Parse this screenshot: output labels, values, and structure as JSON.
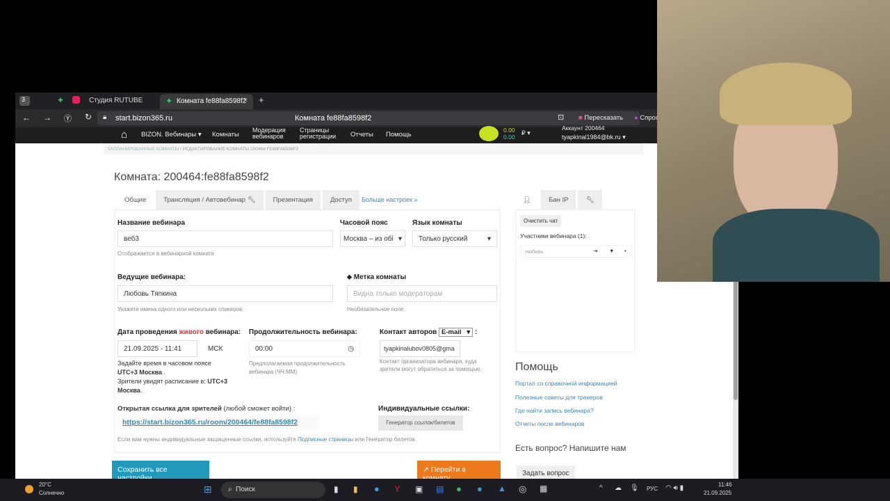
{
  "browser": {
    "tabs": [
      {
        "label": "Студия RUTUBE"
      },
      {
        "label": "Комната fe88fa8598f2"
      }
    ],
    "tab_count": "3",
    "url": "start.bizon365.ru",
    "page_title": "Комната fe88fa8598f2",
    "retell": "Пересказать",
    "ask": "Спросить"
  },
  "nav": {
    "brand": "BIZON. Вебинары",
    "items": [
      "Комнаты",
      "Модерация вебинаров",
      "Страницы регистрации",
      "Отчеты",
      "Помощь"
    ],
    "balance1": "0.00",
    "balance2": "0.00",
    "currency": "₽",
    "account": "Аккаунт 200464",
    "email": "tyapkinal1984@bk.ru"
  },
  "breadcrumb": {
    "item1": "ЗАПЛАНИРОВАННЫЕ КОМНАТЫ",
    "item2": "РЕДАКТИРОВАНИЕ КОМНАТЫ 200464:FE88FA8598F2"
  },
  "room": {
    "title": "Комната: 200464:fe88fa8598f2",
    "tabs": [
      "Общие",
      "Трансляция / Автовебинар",
      "Презентация",
      "Доступ"
    ],
    "more": "Больше настроек »",
    "name_label": "Название вебинара",
    "name_value": "веб3",
    "name_hint": "Отображается в вебинарной комнате",
    "tz_label": "Часовой пояс",
    "tz_value": "Москва – из обі",
    "lang_label": "Язык комнаты",
    "lang_value": "Только русский",
    "hosts_label": "Ведущие вебинара:",
    "hosts_value": "Любовь Тяпкина",
    "hosts_hint": "Укажите имена одного или нескольких спикеров.",
    "tag_label": "Метка комнаты",
    "tag_placeholder": "Видна только модераторам",
    "tag_hint": "Необязательное поле.",
    "date_label_a": "Дата проведения ",
    "date_label_b": "живого",
    "date_label_c": " вебинара:",
    "date_value": "21.09.2025 - 11:41",
    "date_tz": "МСК",
    "date_hint1": "Задайте время в часовом поясе",
    "date_hint2": "UTC+3 Москва",
    "date_hint3": "Зрители увидят расписание в:",
    "date_hint4": "UTC+3 Москва",
    "dur_label": "Продолжительность вебинара:",
    "dur_value": "00:00",
    "dur_hint": "Предполагаемая продолжительность вебинара (ЧЧ:ММ)",
    "contact_label": "Контакт авторов",
    "contact_type": "E-mail",
    "contact_value": "tyapkinalubov0805@gma",
    "contact_hint": "Контакт организатора вебинара, куда зрители могут обратиться за помощью.",
    "open_link_label": "Открытая ссылка для зрителей",
    "open_link_note": "(любой сможет войти) :",
    "open_link": "https://start.bizon365.ru/room/200464/fe88fa8598f2",
    "ind_label": "Индивидуальные ссылки:",
    "ind_button": "Генератор ссылок/билетов",
    "footer_a": "Если вам нужны индивидуальные защищенные ссылки, используйте ",
    "footer_link": "Подписные страницы",
    "footer_b": " или Генератор билетов.",
    "save": "Сохранить все настройки",
    "goto": "Перейти в комнату"
  },
  "side": {
    "ban": "Бан IP",
    "clear": "Очистить чат",
    "participants": "Участники вебинара (1):",
    "participant": "любовь",
    "help_title": "Помощь",
    "help_links": [
      "Портал со справочной информацией",
      "Полезные советы для тренеров",
      "Где найти запись вебинара?",
      "Отчеты после вебинаров"
    ],
    "question": "Есть вопрос? Напишите нам",
    "ask_button": "Задать вопрос"
  },
  "taskbar": {
    "temp": "20°C",
    "weather": "Солнечно",
    "search": "Поиск",
    "lang": "РУС",
    "time": "11:46",
    "date": "21.09.2025"
  }
}
